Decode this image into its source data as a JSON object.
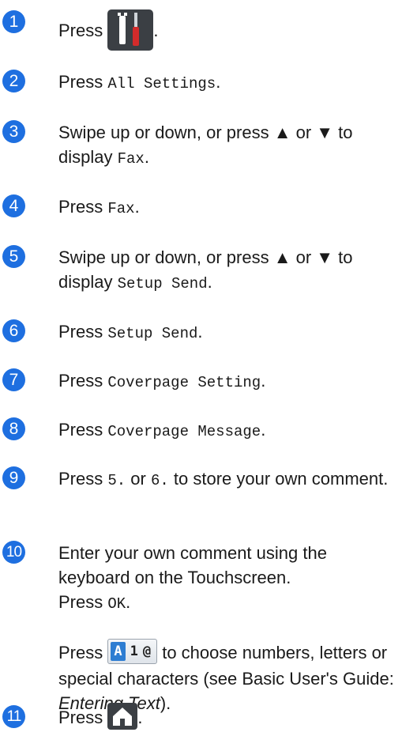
{
  "steps": [
    {
      "n": "1",
      "parts": [
        {
          "t": "Press "
        },
        {
          "icon": "tools-icon"
        },
        {
          "t": "."
        }
      ]
    },
    {
      "n": "2",
      "parts": [
        {
          "t": "Press "
        },
        {
          "m": "All Settings"
        },
        {
          "t": "."
        }
      ]
    },
    {
      "n": "3",
      "parts": [
        {
          "t": "Swipe up or down, or press ▲ or ▼ to display "
        },
        {
          "m": "Fax"
        },
        {
          "t": "."
        }
      ]
    },
    {
      "n": "4",
      "parts": [
        {
          "t": "Press "
        },
        {
          "m": "Fax"
        },
        {
          "t": "."
        }
      ]
    },
    {
      "n": "5",
      "parts": [
        {
          "t": "Swipe up or down, or press ▲ or ▼ to display "
        },
        {
          "m": "Setup Send"
        },
        {
          "t": "."
        }
      ]
    },
    {
      "n": "6",
      "parts": [
        {
          "t": "Press "
        },
        {
          "m": "Setup Send"
        },
        {
          "t": "."
        }
      ]
    },
    {
      "n": "7",
      "parts": [
        {
          "t": "Press "
        },
        {
          "m": "Coverpage Setting"
        },
        {
          "t": "."
        }
      ]
    },
    {
      "n": "8",
      "parts": [
        {
          "t": "Press "
        },
        {
          "m": "Coverpage Message"
        },
        {
          "t": "."
        }
      ]
    },
    {
      "n": "9",
      "parts": [
        {
          "t": "Press "
        },
        {
          "m": "5."
        },
        {
          "t": " or "
        },
        {
          "m": "6."
        },
        {
          "t": " to store your own comment."
        }
      ]
    },
    {
      "n": "10",
      "parts": [
        {
          "t": "Enter your own comment using the keyboard on the Touchscreen."
        },
        {
          "br": true
        },
        {
          "t": "Press "
        },
        {
          "m": "OK"
        },
        {
          "t": "."
        }
      ]
    },
    {
      "n": "11",
      "parts": [
        {
          "t": "Press "
        },
        {
          "icon": "home-icon"
        },
        {
          "t": "."
        }
      ]
    }
  ],
  "note": {
    "before": "Press ",
    "key": {
      "a": "A",
      "one": "1",
      "at": "@"
    },
    "middle": " to choose numbers, letters or special characters (see Basic User's Guide: ",
    "ref": "Entering Text",
    "after": ")."
  },
  "colors": {
    "badge": "#1e6fe0",
    "icon_bg": "#3b3f44"
  }
}
